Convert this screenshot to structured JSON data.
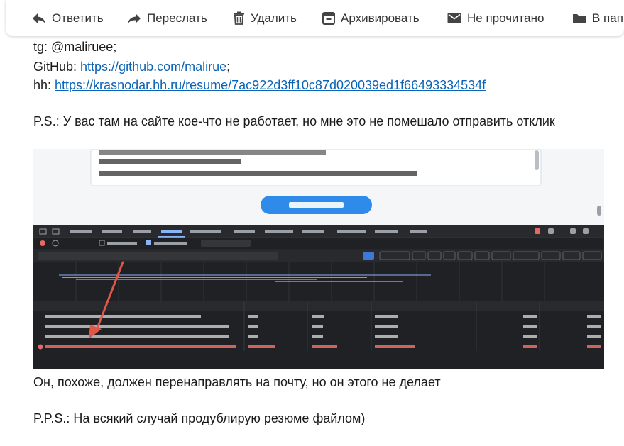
{
  "toolbar": {
    "reply_label": "Ответить",
    "forward_label": "Переслать",
    "delete_label": "Удалить",
    "archive_label": "Архивировать",
    "unread_label": "Не прочитано",
    "folder_label": "В папку"
  },
  "message": {
    "tg_text": "tg: @maliruee;",
    "github_prefix": "GitHub: ",
    "github_link": "https://github.com/malirue",
    "github_suffix": ";",
    "hh_prefix": "hh: ",
    "hh_link": "https://krasnodar.hh.ru/resume/7ac922d3ff10c87d020039ed1f66493334534f",
    "ps_text": "P.S.: У вас там на сайте кое-что не работает, но мне это не помешало отправить отклик",
    "after_text": "Он, похоже, должен перенаправлять на почту, но он этого не делает",
    "pps_text": "P.P.S.: На всякий случай продублирую резюме файлом)"
  }
}
